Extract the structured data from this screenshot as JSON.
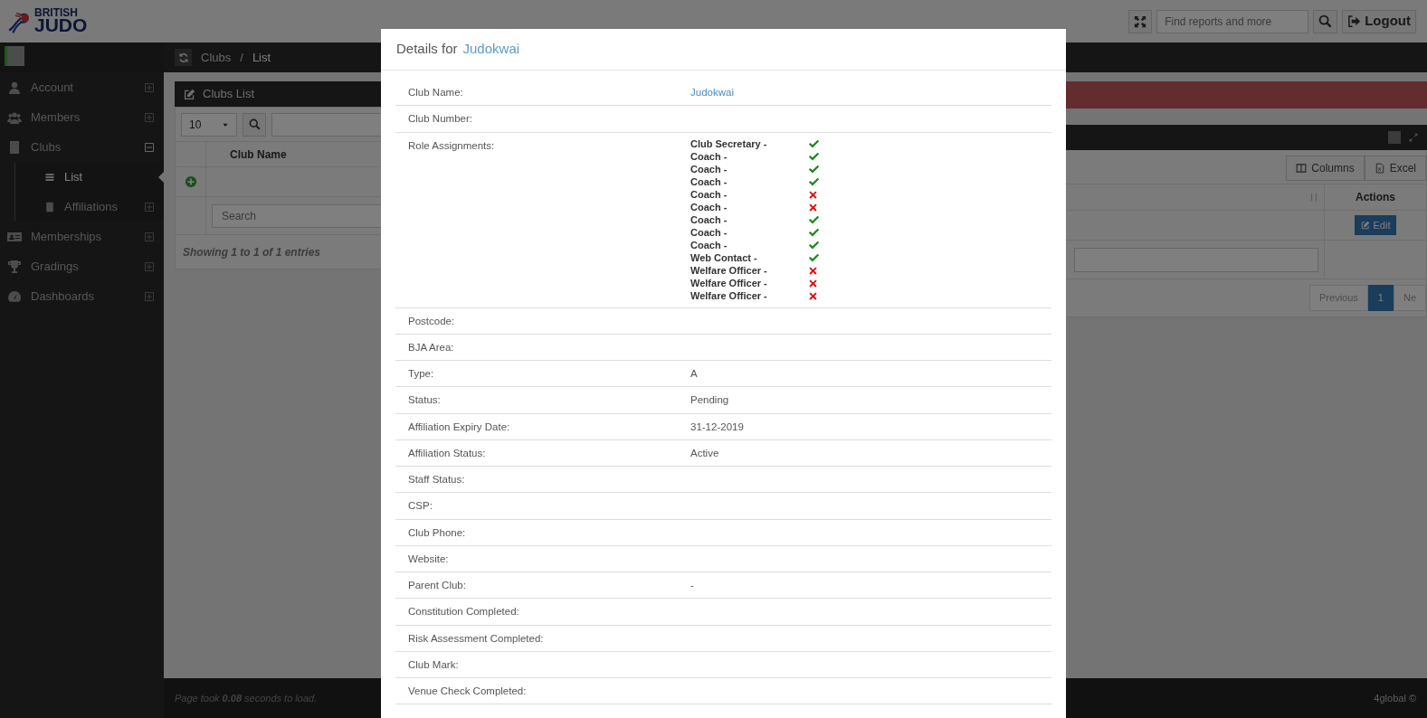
{
  "header": {
    "logo": {
      "line_1": "BRITISH",
      "line_2": "JUDO"
    },
    "search": {
      "placeholder": "Find reports and more"
    },
    "logout": "Logout"
  },
  "sidebar": {
    "items": [
      {
        "label": "Account",
        "expanded": false,
        "selected": false
      },
      {
        "label": "Members",
        "expanded": false,
        "selected": false
      },
      {
        "label": "Clubs",
        "expanded": true,
        "selected": false,
        "children": [
          {
            "label": "List",
            "selected": true
          },
          {
            "label": "Affiliations",
            "selected": false,
            "expanded": false
          }
        ]
      },
      {
        "label": "Memberships",
        "expanded": false,
        "selected": false
      },
      {
        "label": "Gradings",
        "expanded": false,
        "selected": false
      },
      {
        "label": "Dashboards",
        "expanded": false,
        "selected": false
      }
    ]
  },
  "breadcrumb": [
    "Clubs",
    "/",
    "List"
  ],
  "clubs_panel": {
    "title": "Clubs List",
    "page_size": "10",
    "column": "Club Name",
    "search_placeholder": "Search",
    "info": "Showing 1 to 1 of 1 entries"
  },
  "right_panel": {
    "buttons": [
      "Columns",
      "Excel"
    ],
    "column": "Actions",
    "edit": "Edit",
    "pagination": [
      {
        "label": "Previous",
        "selected": false
      },
      {
        "label": "1",
        "selected": true
      },
      {
        "label": "Ne",
        "selected": false
      }
    ]
  },
  "footer": {
    "load_time": "Page took **0.08** seconds to load.",
    "copyright": "4global ©"
  },
  "modal": {
    "title": "Details for",
    "club": "Judokwai",
    "rows": [
      {
        "label": "Club Name:",
        "kind": "link",
        "value": "Judokwai"
      },
      {
        "label": "Club Number:",
        "kind": "text"
      },
      {
        "label": "Role Assignments:",
        "kind": "roles",
        "roles": [
          {
            "role": "Club Secretary -",
            "ok": true
          },
          {
            "role": "Coach -",
            "ok": true
          },
          {
            "role": "Coach -",
            "ok": true
          },
          {
            "role": "Coach -",
            "ok": true
          },
          {
            "role": "Coach -",
            "ok": false
          },
          {
            "role": "Coach -",
            "ok": false
          },
          {
            "role": "Coach -",
            "ok": true
          },
          {
            "role": "Coach -",
            "ok": true
          },
          {
            "role": "Coach -",
            "ok": true
          },
          {
            "role": "Web Contact -",
            "ok": true
          },
          {
            "role": "Welfare Officer -",
            "ok": false
          },
          {
            "role": "Welfare Officer -",
            "ok": false
          },
          {
            "role": "Welfare Officer -",
            "ok": false
          }
        ]
      },
      {
        "label": "Postcode:",
        "kind": "text"
      },
      {
        "label": "BJA Area:",
        "kind": "text"
      },
      {
        "label": "Type:",
        "kind": "text",
        "value": "A"
      },
      {
        "label": "Status:",
        "kind": "text",
        "value": "Pending"
      },
      {
        "label": "Affiliation Expiry Date:",
        "kind": "text",
        "value": "31-12-2019"
      },
      {
        "label": "Affiliation Status:",
        "kind": "text",
        "value": "Active"
      },
      {
        "label": "Staff Status:",
        "kind": "text"
      },
      {
        "label": "CSP:",
        "kind": "text"
      },
      {
        "label": "Club Phone:",
        "kind": "text"
      },
      {
        "label": "Website:",
        "kind": "text"
      },
      {
        "label": "Parent Club:",
        "kind": "text",
        "value": "-"
      },
      {
        "label": "Constitution Completed:",
        "kind": "text"
      },
      {
        "label": "Risk Assessment Completed:",
        "kind": "text"
      },
      {
        "label": "Club Mark:",
        "kind": "text"
      },
      {
        "label": "Venue Check Completed:",
        "kind": "text"
      }
    ]
  }
}
